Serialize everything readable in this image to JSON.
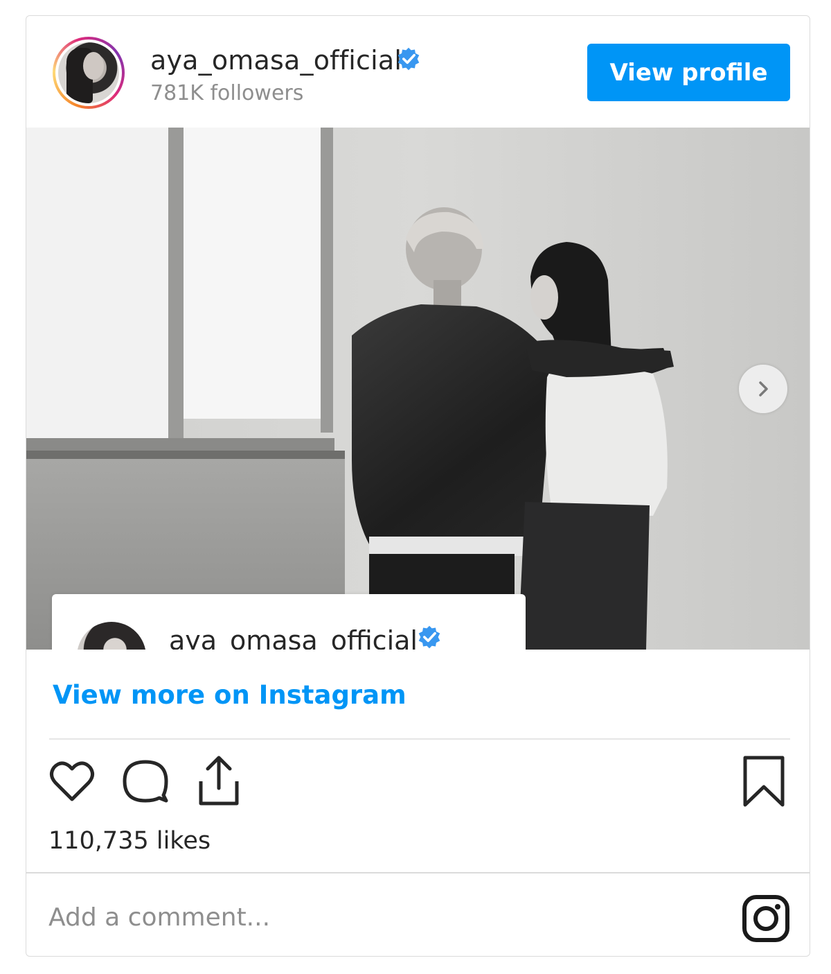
{
  "header": {
    "username": "aya_omasa_official",
    "followers": "781K followers",
    "view_profile_label": "View profile",
    "verified_icon": "verified-badge-icon"
  },
  "photo": {
    "overlay_username": "aya_omasa_official",
    "next_icon": "chevron-right-icon"
  },
  "footer": {
    "view_more_label": "View more on Instagram",
    "likes": "110,735 likes",
    "comment_placeholder": "Add a comment...",
    "icons": [
      "heart-icon",
      "comment-bubble-icon",
      "share-icon",
      "bookmark-icon",
      "instagram-logo-icon"
    ]
  },
  "colors": {
    "accent": "#0095f6",
    "text": "#262626",
    "muted": "#8e8e8e",
    "border": "#dbdbdb"
  }
}
